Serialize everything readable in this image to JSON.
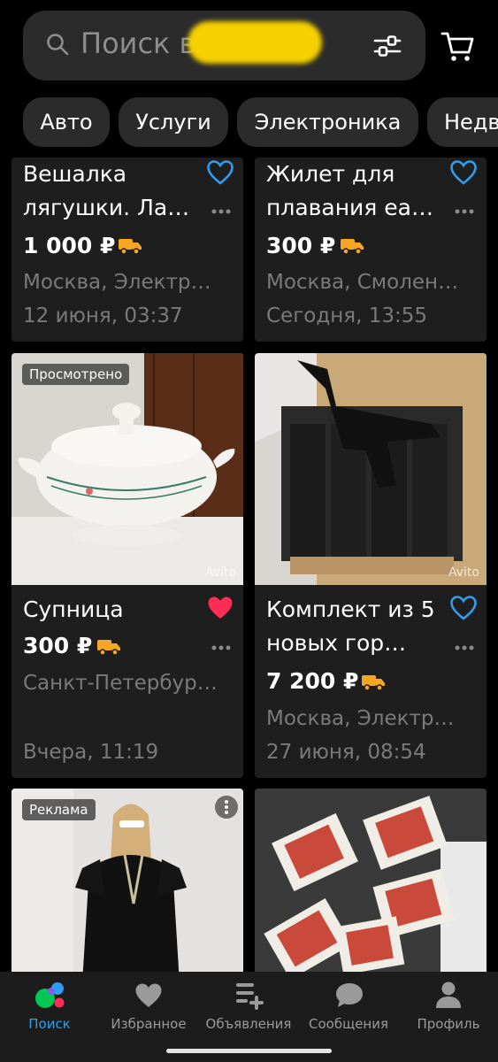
{
  "search": {
    "placeholder": "Поиск в"
  },
  "categories": [
    "Авто",
    "Услуги",
    "Электроника",
    "Недв"
  ],
  "listings": [
    {
      "title": "Вешалка лягушки. Ла…",
      "price": "1 000 ₽",
      "location": "Москва, Электр…",
      "date": "12 июня, 03:37",
      "favorite": false
    },
    {
      "title": "Жилет для плавания еа…",
      "price": "300 ₽",
      "location": "Москва, Смолен…",
      "date": "Сегодня, 13:55",
      "favorite": false
    },
    {
      "badge": "Просмотрено",
      "watermark": "Avito",
      "title": "Супница",
      "price": "300 ₽",
      "location": "Санкт-Петербур…",
      "date": "Вчера, 11:19",
      "favorite": true
    },
    {
      "watermark": "Avito",
      "title": "Комплект из 5 новых гор…",
      "price": "7 200 ₽",
      "location": "Москва, Электр…",
      "date": "27 июня, 08:54",
      "favorite": false
    },
    {
      "badge": "Реклама"
    },
    {}
  ],
  "nav": [
    {
      "label": "Поиск",
      "icon": "search-logo-icon",
      "active": true
    },
    {
      "label": "Избранное",
      "icon": "heart-icon"
    },
    {
      "label": "Объявления",
      "icon": "listings-add-icon"
    },
    {
      "label": "Сообщения",
      "icon": "chat-bubble-icon"
    },
    {
      "label": "Профиль",
      "icon": "profile-icon"
    }
  ],
  "colors": {
    "accent_blue": "#2f9ef0",
    "heart_red": "#ff2d55",
    "truck_orange": "#f5a623",
    "nav_active": "#2f9ef0"
  }
}
